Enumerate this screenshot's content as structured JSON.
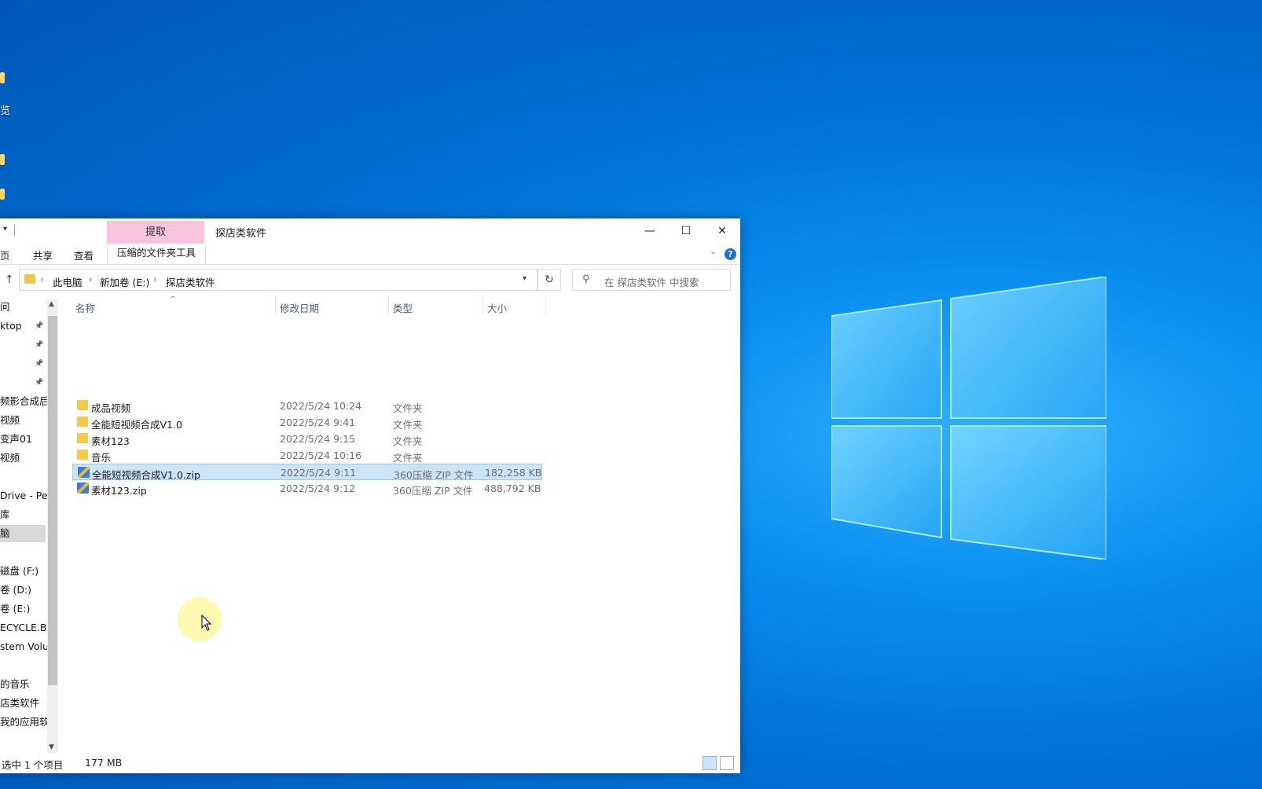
{
  "desktop": {
    "icon_labels": [
      "览",
      "",
      ""
    ]
  },
  "window": {
    "title": "探店类软件",
    "context_tab": "提取",
    "ribbon_tabs": [
      "页",
      "共享",
      "查看"
    ],
    "tool_tab": "压缩的文件夹工具",
    "help": "?",
    "controls": {
      "minimize": "—",
      "maximize": "☐",
      "close": "✕"
    }
  },
  "address": {
    "crumbs": [
      "此电脑",
      "新加卷 (E:)",
      "探店类软件"
    ],
    "search_placeholder": "在 探店类软件 中搜索"
  },
  "nav": [
    {
      "label": "问",
      "pinned": false,
      "selected": false
    },
    {
      "label": "ktop",
      "pinned": true,
      "selected": false
    },
    {
      "label": "",
      "pinned": true,
      "selected": false
    },
    {
      "label": "",
      "pinned": true,
      "selected": false
    },
    {
      "label": "",
      "pinned": true,
      "selected": false
    },
    {
      "label": "频影合成后",
      "pinned": false,
      "selected": false
    },
    {
      "label": "视频",
      "pinned": false,
      "selected": false
    },
    {
      "label": "变声01",
      "pinned": false,
      "selected": false
    },
    {
      "label": "视频",
      "pinned": false,
      "selected": false
    },
    {
      "label": "",
      "pinned": false,
      "selected": false
    },
    {
      "label": "Drive - Per",
      "pinned": false,
      "selected": false
    },
    {
      "label": "库",
      "pinned": false,
      "selected": false
    },
    {
      "label": "脑",
      "pinned": false,
      "selected": true
    },
    {
      "label": "",
      "pinned": false,
      "selected": false
    },
    {
      "label": "磁盘 (F:)",
      "pinned": false,
      "selected": false
    },
    {
      "label": "卷 (D:)",
      "pinned": false,
      "selected": false
    },
    {
      "label": "卷 (E:)",
      "pinned": false,
      "selected": false
    },
    {
      "label": "ECYCLE.BIN",
      "pinned": false,
      "selected": false
    },
    {
      "label": "stem Volum",
      "pinned": false,
      "selected": false
    },
    {
      "label": "",
      "pinned": false,
      "selected": false
    },
    {
      "label": "的音乐",
      "pinned": false,
      "selected": false
    },
    {
      "label": "店类软件",
      "pinned": false,
      "selected": false
    },
    {
      "label": "我的应用软件",
      "pinned": false,
      "selected": false
    }
  ],
  "columns": {
    "name": "名称",
    "date": "修改日期",
    "type": "类型",
    "size": "大小"
  },
  "files": [
    {
      "name": "成品视频",
      "date": "2022/5/24 10:24",
      "type": "文件夹",
      "size": "",
      "kind": "folder"
    },
    {
      "name": "全能短视频合成V1.0",
      "date": "2022/5/24 9:41",
      "type": "文件夹",
      "size": "",
      "kind": "folder"
    },
    {
      "name": "素材123",
      "date": "2022/5/24 9:15",
      "type": "文件夹",
      "size": "",
      "kind": "folder"
    },
    {
      "name": "音乐",
      "date": "2022/5/24 10:16",
      "type": "文件夹",
      "size": "",
      "kind": "folder"
    },
    {
      "name": "全能短视频合成V1.0.zip",
      "date": "2022/5/24 9:11",
      "type": "360压缩 ZIP 文件",
      "size": "182,258 KB",
      "kind": "zip",
      "selected": true
    },
    {
      "name": "素材123.zip",
      "date": "2022/5/24 9:12",
      "type": "360压缩 ZIP 文件",
      "size": "488,792 KB",
      "kind": "zip"
    }
  ],
  "status": {
    "selection": "选中 1 个项目",
    "size": "177 MB"
  },
  "colors": {
    "desktop_blue": "#0070d6",
    "selection": "#cce4f7",
    "context_tab": "#f9c5dc",
    "folder": "#f7c948"
  }
}
